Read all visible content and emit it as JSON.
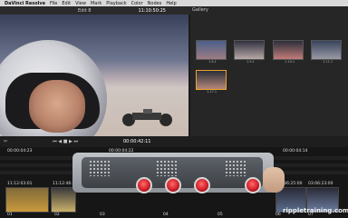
{
  "menubar": {
    "items": [
      "DaVinci Resolve",
      "File",
      "Edit",
      "View",
      "Mark",
      "Playback",
      "Color",
      "Nodes",
      "Help"
    ]
  },
  "toolbar": {
    "edit_label": "Edit 8",
    "timecode": "11:10:50:25"
  },
  "gallery": {
    "title": "Gallery",
    "thumbs": [
      {
        "label": "1.8.1"
      },
      {
        "label": "1.9.1"
      },
      {
        "label": "1.10.1"
      },
      {
        "label": "1.11.1"
      },
      {
        "label": "1.17.1"
      }
    ]
  },
  "transport": {
    "timecode": "00:00:42:11"
  },
  "timeline": {
    "marks": [
      "00:00:04:23",
      "00:00:04:22",
      "00:00:04:14"
    ],
    "clip_codes": [
      "11:12:03:01",
      "11:12:46:19",
      "03:36:25:00",
      "03:06:23:00"
    ],
    "bottom_codes": [
      "01",
      "02",
      "03",
      "04",
      "05",
      "06",
      "07"
    ]
  },
  "watermark": "rippletraining.com"
}
